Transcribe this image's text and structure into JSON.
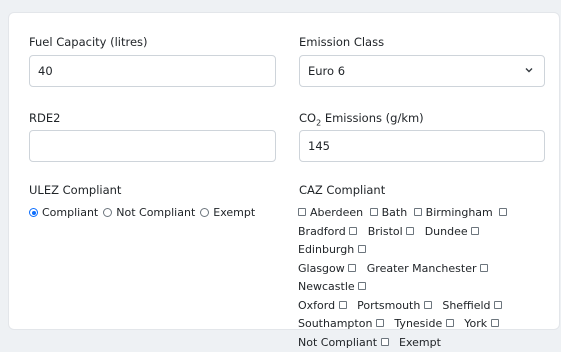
{
  "fields": {
    "fuel_capacity": {
      "label": "Fuel Capacity (litres)",
      "value": "40"
    },
    "emission_class": {
      "label": "Emission Class",
      "value": "Euro 6"
    },
    "rde2": {
      "label": "RDE2",
      "value": ""
    },
    "co2": {
      "label_prefix": "CO",
      "label_sub": "2",
      "label_suffix": " Emissions (g/km)",
      "value": "145"
    }
  },
  "ulez": {
    "label": "ULEZ Compliant",
    "options": [
      "Compliant",
      "Not Compliant",
      "Exempt"
    ],
    "selected": "Compliant"
  },
  "caz": {
    "label": "CAZ Compliant",
    "options": [
      "Aberdeen",
      "Bath",
      "Birmingham",
      "Bradford",
      "Bristol",
      "Dundee",
      "Edinburgh",
      "Glasgow",
      "Greater Manchester",
      "Newcastle",
      "Oxford",
      "Portsmouth",
      "Sheffield",
      "Southampton",
      "Tyneside",
      "York",
      "Not Compliant",
      "Exempt"
    ]
  },
  "colors": {
    "accent": "#0d6efd",
    "border": "#ced4da"
  }
}
